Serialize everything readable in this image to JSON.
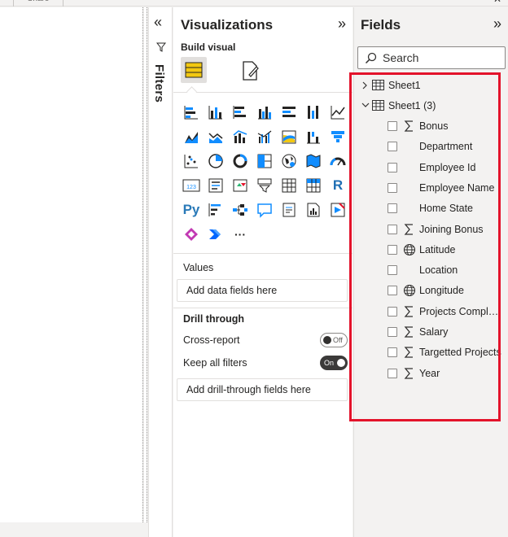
{
  "topbar": {
    "share_label": "Share",
    "close_glyph": "✕"
  },
  "filters": {
    "label": "Filters",
    "collapse_glyph": "«",
    "icon": "funnel-icon"
  },
  "visualizations": {
    "title": "Visualizations",
    "expand_glyph": "»",
    "build_visual_label": "Build visual",
    "more_glyph": "···",
    "python_label": "Py",
    "r_label": "R",
    "card_label": "123",
    "values_label": "Values",
    "values_drop": "Add data fields here",
    "drill_title": "Drill through",
    "cross_report_label": "Cross-report",
    "cross_report_state": "Off",
    "keep_filters_label": "Keep all filters",
    "keep_filters_state": "On",
    "drill_drop": "Add drill-through fields here"
  },
  "fields": {
    "title": "Fields",
    "expand_glyph": "»",
    "search_placeholder": "Search",
    "tables": [
      {
        "name": "Sheet1",
        "expanded": false
      },
      {
        "name": "Sheet1 (3)",
        "expanded": true
      }
    ],
    "items": [
      {
        "label": "Bonus",
        "icon": "sigma"
      },
      {
        "label": "Department",
        "icon": "none"
      },
      {
        "label": "Employee Id",
        "icon": "none"
      },
      {
        "label": "Employee Name",
        "icon": "none"
      },
      {
        "label": "Home State",
        "icon": "none"
      },
      {
        "label": "Joining Bonus",
        "icon": "sigma"
      },
      {
        "label": "Latitude",
        "icon": "globe"
      },
      {
        "label": "Location",
        "icon": "none"
      },
      {
        "label": "Longitude",
        "icon": "globe"
      },
      {
        "label": "Projects Complet...",
        "icon": "sigma"
      },
      {
        "label": "Salary",
        "icon": "sigma"
      },
      {
        "label": "Targetted Projects",
        "icon": "sigma"
      },
      {
        "label": "Year",
        "icon": "sigma"
      }
    ]
  },
  "colors": {
    "highlight": "#e3132b",
    "accent_blue": "#118dff",
    "accent_yellow": "#f2c811"
  }
}
